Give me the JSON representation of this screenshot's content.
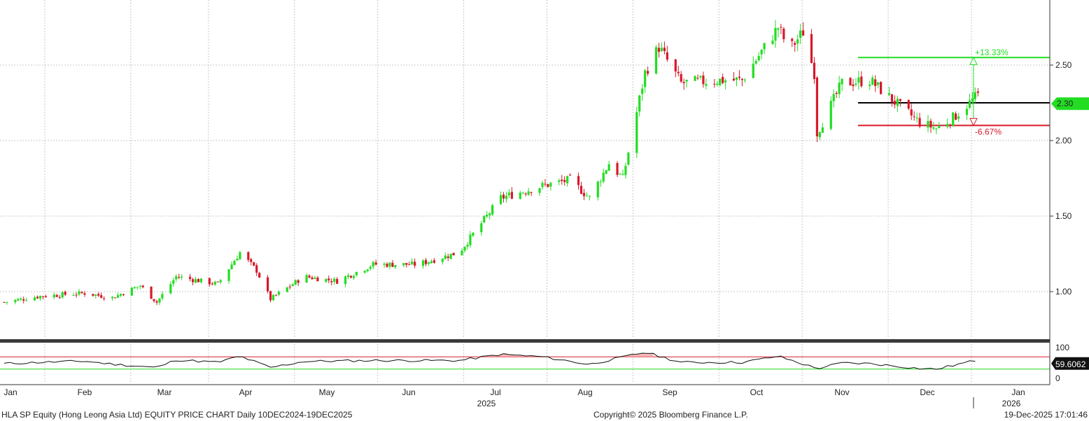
{
  "footer": {
    "left": "HLA SP Equity (Hong Leong Asia Ltd) EQUITY PRICE CHART Daily 10DEC2024-19DEC2025",
    "center": "Copyright© 2025 Bloomberg Finance L.P.",
    "right": "19-Dec-2025 17:01:46"
  },
  "colors": {
    "up": "#22dd22",
    "down": "#d8192a",
    "grid": "#c8c8c8",
    "last_tag": "#22dd22",
    "rsi_line": "#111111"
  },
  "chart_data": [
    {
      "type": "candlestick",
      "title": "",
      "xlabel": "",
      "ylabel": "",
      "grid": true,
      "ylim": [
        0.7,
        2.85
      ],
      "y_ticks": [
        "1.00",
        "1.50",
        "2.00",
        "2.50"
      ],
      "last_price_label": "2.30",
      "levels": [
        {
          "name": "upper",
          "value": 2.55,
          "label": "+13.33%",
          "color": "#22dd22"
        },
        {
          "name": "current",
          "value": 2.25,
          "label": "",
          "color": "#000000"
        },
        {
          "name": "lower",
          "value": 2.1,
          "label": "-6.67%",
          "color": "#d8192a"
        }
      ],
      "x_ticks": [
        "Jan",
        "Feb",
        "Mar",
        "Apr",
        "May",
        "Jun",
        "Jul",
        "Aug",
        "Sep",
        "Oct",
        "Nov",
        "Dec",
        "Jan"
      ],
      "x_year_labels": [
        "2025",
        "2026"
      ],
      "close_path": [
        [
          "2025-01-02",
          0.93
        ],
        [
          "2025-01-15",
          0.97
        ],
        [
          "2025-01-31",
          0.99
        ],
        [
          "2025-02-10",
          0.96
        ],
        [
          "2025-02-20",
          1.04
        ],
        [
          "2025-02-26",
          0.93
        ],
        [
          "2025-03-05",
          1.1
        ],
        [
          "2025-03-20",
          1.05
        ],
        [
          "2025-03-28",
          1.26
        ],
        [
          "2025-04-03",
          1.14
        ],
        [
          "2025-04-08",
          0.95
        ],
        [
          "2025-04-20",
          1.1
        ],
        [
          "2025-05-02",
          1.07
        ],
        [
          "2025-05-15",
          1.18
        ],
        [
          "2025-05-31",
          1.18
        ],
        [
          "2025-06-15",
          1.26
        ],
        [
          "2025-06-30",
          1.62
        ],
        [
          "2025-07-15",
          1.7
        ],
        [
          "2025-07-25",
          1.74
        ],
        [
          "2025-08-01",
          1.62
        ],
        [
          "2025-08-08",
          1.85
        ],
        [
          "2025-08-13",
          1.75
        ],
        [
          "2025-08-21",
          2.45
        ],
        [
          "2025-08-26",
          2.62
        ],
        [
          "2025-09-03",
          2.38
        ],
        [
          "2025-09-17",
          2.4
        ],
        [
          "2025-09-25",
          2.4
        ],
        [
          "2025-10-08",
          2.75
        ],
        [
          "2025-10-12",
          2.6
        ],
        [
          "2025-10-17",
          2.72
        ],
        [
          "2025-10-21",
          2.45
        ],
        [
          "2025-10-22",
          2.05
        ],
        [
          "2025-10-31",
          2.38
        ],
        [
          "2025-11-10",
          2.4
        ],
        [
          "2025-11-20",
          2.24
        ],
        [
          "2025-11-28",
          2.12
        ],
        [
          "2025-12-04",
          2.08
        ],
        [
          "2025-12-10",
          2.15
        ],
        [
          "2025-12-19",
          2.3
        ]
      ]
    },
    {
      "type": "line",
      "name": "RSI",
      "ylim": [
        0,
        100
      ],
      "y_ticks": [
        "0",
        "100"
      ],
      "levels": [
        70,
        30
      ],
      "last_value_label": "59.6062",
      "rsi_path": [
        [
          "2025-01-02",
          48
        ],
        [
          "2025-01-15",
          52
        ],
        [
          "2025-01-31",
          56
        ],
        [
          "2025-02-10",
          46
        ],
        [
          "2025-02-26",
          35
        ],
        [
          "2025-03-05",
          60
        ],
        [
          "2025-03-20",
          52
        ],
        [
          "2025-03-28",
          72
        ],
        [
          "2025-04-08",
          35
        ],
        [
          "2025-04-20",
          55
        ],
        [
          "2025-05-15",
          58
        ],
        [
          "2025-06-15",
          58
        ],
        [
          "2025-06-30",
          78
        ],
        [
          "2025-07-15",
          70
        ],
        [
          "2025-08-01",
          45
        ],
        [
          "2025-08-21",
          85
        ],
        [
          "2025-09-03",
          52
        ],
        [
          "2025-09-25",
          52
        ],
        [
          "2025-10-08",
          72
        ],
        [
          "2025-10-22",
          32
        ],
        [
          "2025-10-31",
          50
        ],
        [
          "2025-11-10",
          48
        ],
        [
          "2025-11-28",
          32
        ],
        [
          "2025-12-04",
          30
        ],
        [
          "2025-12-19",
          60
        ]
      ]
    }
  ]
}
